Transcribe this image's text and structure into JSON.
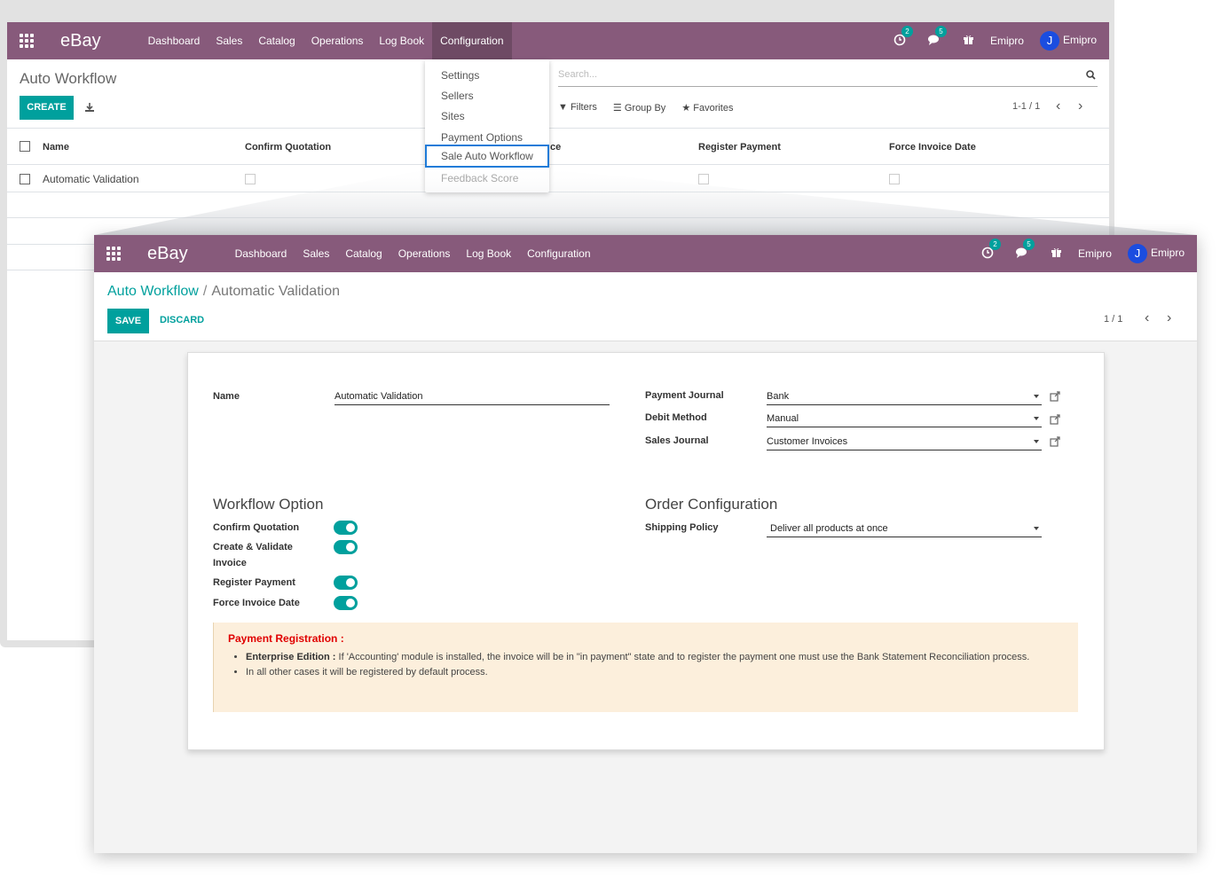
{
  "navbar": {
    "brand": "eBay",
    "menu": [
      "Dashboard",
      "Sales",
      "Catalog",
      "Operations",
      "Log Book",
      "Configuration"
    ],
    "activity_count": "2",
    "message_count": "5",
    "company": "Emipro",
    "user": "Emipro",
    "accent_color": "#875a7b"
  },
  "list_view": {
    "title": "Auto Workflow",
    "create_label": "CREATE",
    "search_placeholder": "Search...",
    "filters_label": "Filters",
    "group_by_label": "Group By",
    "favorites_label": "Favorites",
    "pager": "1-1 / 1",
    "columns": [
      "Name",
      "Confirm Quotation",
      "ce",
      "Register Payment",
      "Force Invoice Date"
    ],
    "rows": [
      {
        "name": "Automatic Validation"
      }
    ]
  },
  "config_menu": {
    "items": [
      "Settings",
      "Sellers",
      "Sites",
      "Payment Options",
      "Sale Auto Workflow",
      "Feedback Score"
    ],
    "active": "Sale Auto Workflow"
  },
  "form_view": {
    "breadcrumb_parent": "Auto Workflow",
    "breadcrumb_sep": "/",
    "breadcrumb_current": "Automatic Validation",
    "save_label": "SAVE",
    "discard_label": "DISCARD",
    "pager": "1 / 1",
    "name_label": "Name",
    "name_value": "Automatic Validation",
    "payment_journal_label": "Payment Journal",
    "payment_journal_value": "Bank",
    "debit_method_label": "Debit Method",
    "debit_method_value": "Manual",
    "sales_journal_label": "Sales Journal",
    "sales_journal_value": "Customer Invoices",
    "workflow_section": "Workflow Option",
    "confirm_quotation_label": "Confirm Quotation",
    "create_validate_label_1": "Create & Validate",
    "create_validate_label_2": "Invoice",
    "register_payment_label": "Register Payment",
    "force_invoice_date_label": "Force Invoice Date",
    "order_section": "Order Configuration",
    "shipping_policy_label": "Shipping Policy",
    "shipping_policy_value": "Deliver all products at once",
    "alert_title": "Payment Registration :",
    "alert_item1_bold": "Enterprise Edition :",
    "alert_item1_text": " If 'Accounting' module is installed, the invoice will be in \"in payment\" state and to register the payment one must use the Bank Statement Reconciliation process.",
    "alert_item2_text": "In all other cases it will be registered by default process."
  }
}
